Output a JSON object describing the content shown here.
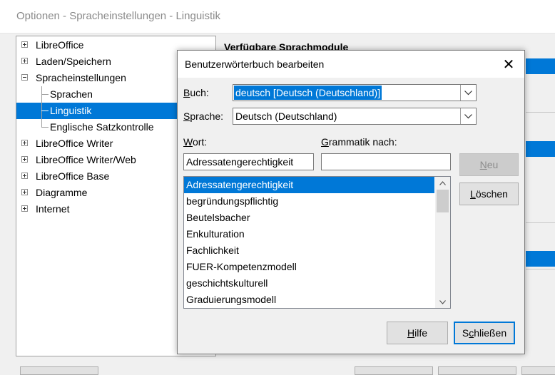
{
  "window": {
    "title": "Optionen - Spracheinstellungen - Linguistik"
  },
  "tree": [
    {
      "label": "LibreOffice",
      "expander": "plus"
    },
    {
      "label": "Laden/Speichern",
      "expander": "plus"
    },
    {
      "label": "Spracheinstellungen",
      "expander": "minus"
    },
    {
      "label": "Sprachen",
      "expander": "none"
    },
    {
      "label": "Linguistik",
      "expander": "none",
      "selected": true
    },
    {
      "label": "Englische Satzkontrolle",
      "expander": "none"
    },
    {
      "label": "LibreOffice Writer",
      "expander": "plus"
    },
    {
      "label": "LibreOffice Writer/Web",
      "expander": "plus"
    },
    {
      "label": "LibreOffice Base",
      "expander": "plus"
    },
    {
      "label": "Diagramme",
      "expander": "plus"
    },
    {
      "label": "Internet",
      "expander": "plus"
    }
  ],
  "panel": {
    "title": "Verfügbare Sprachmodule"
  },
  "dialog": {
    "title": "Benutzerwörterbuch bearbeiten",
    "close_icon": "✕",
    "book_label_mn": "B",
    "book_label_rest": "uch:",
    "book_value": "deutsch [Deutsch (Deutschland)]",
    "lang_label_mn": "S",
    "lang_label_rest": "prache:",
    "lang_value": "Deutsch (Deutschland)",
    "word_label_mn": "W",
    "word_label_rest": "ort:",
    "grammar_label_mn": "G",
    "grammar_label_rest": "rammatik nach:",
    "word_value": "Adressatengerechtigkeit",
    "grammar_value": "",
    "new_mn": "N",
    "new_rest": "eu",
    "delete_mn": "L",
    "delete_rest": "öschen",
    "help_mn": "H",
    "help_rest": "ilfe",
    "close_pre": "S",
    "close_mn": "c",
    "close_rest": "hließen",
    "words": [
      "Adressatengerechtigkeit",
      "begründungspflichtig",
      "Beutelsbacher",
      "Enkulturation",
      "Fachlichkeit",
      "FUER-Kompetenzmodell",
      "geschichtskulturell",
      "Graduierungsmodell"
    ],
    "selected_index": 0
  },
  "colors": {
    "accent": "#0078d7"
  }
}
